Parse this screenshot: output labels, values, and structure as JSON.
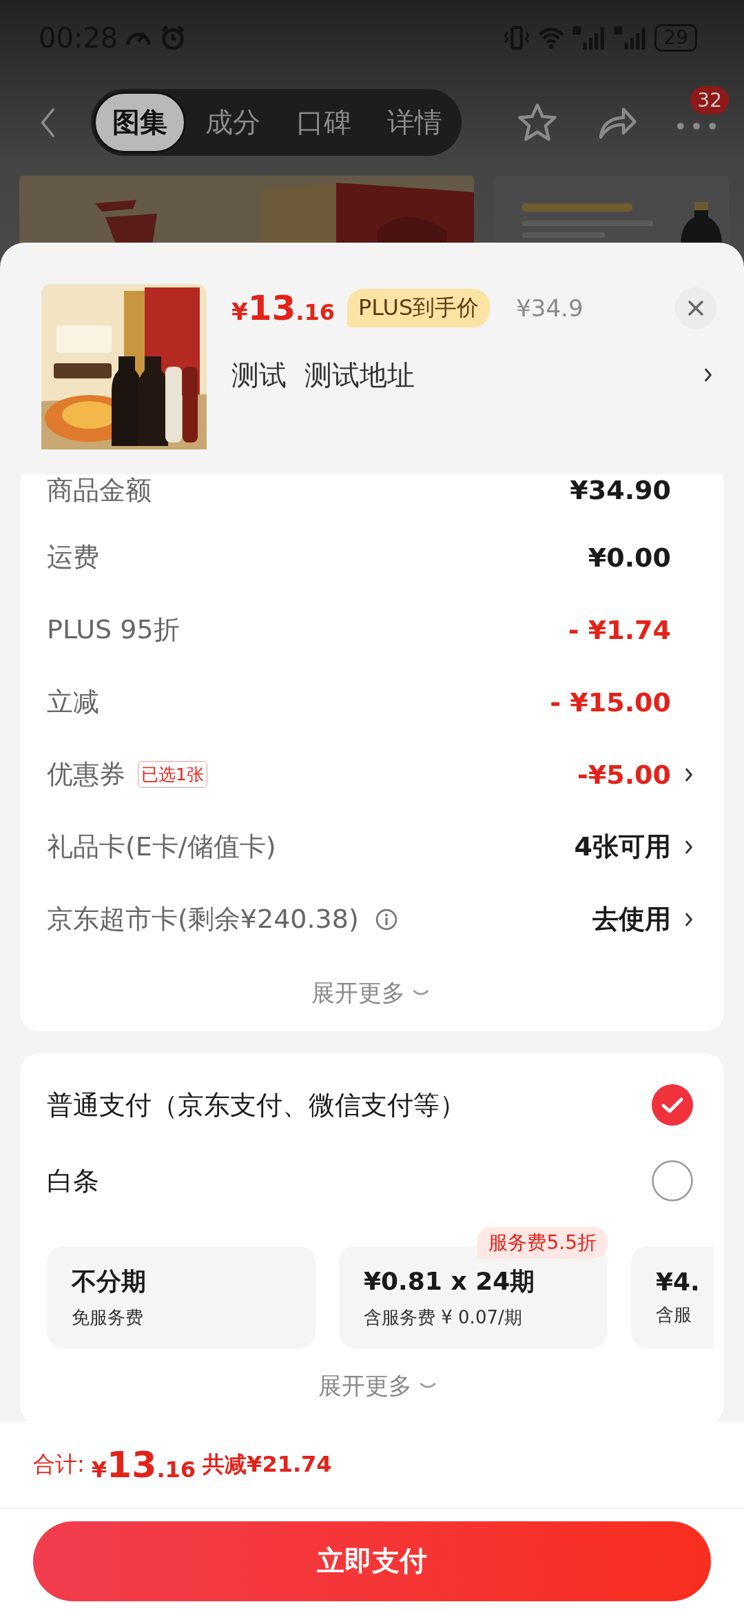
{
  "status_bar": {
    "time": "00:28",
    "battery": "29"
  },
  "nav": {
    "tabs": [
      {
        "label": "图集",
        "selected": true
      },
      {
        "label": "成分",
        "selected": false
      },
      {
        "label": "口碑",
        "selected": false
      },
      {
        "label": "详情",
        "selected": false
      }
    ],
    "badge": "32"
  },
  "product": {
    "currency": "¥",
    "price_main": "13",
    "price_decimal": ".16",
    "price_tag": "PLUS到手价",
    "original_price": "¥34.9",
    "recipient": "测试",
    "address": "测试地址"
  },
  "summary": {
    "rows": [
      {
        "label": "商品金额",
        "value": "¥34.90",
        "kind": "plain",
        "arrow": false
      },
      {
        "label": "运费",
        "value": "¥0.00",
        "kind": "plain",
        "arrow": false
      },
      {
        "label": "PLUS 95折",
        "value": "- ¥1.74",
        "kind": "discount",
        "arrow": false
      },
      {
        "label": "立减",
        "value": "- ¥15.00",
        "kind": "discount",
        "arrow": false
      },
      {
        "label": "优惠券",
        "tag": "已选1张",
        "value": "-¥5.00",
        "kind": "discount",
        "arrow": true
      },
      {
        "label": "礼品卡(E卡/储值卡)",
        "value": "4张可用",
        "kind": "plain",
        "arrow": true
      },
      {
        "label": "京东超市卡(剩余¥240.38)",
        "info": true,
        "value": "去使用",
        "kind": "plain",
        "arrow": true
      }
    ],
    "more": "展开更多"
  },
  "payment": {
    "methods": [
      {
        "label": "普通支付（京东支付、微信支付等）",
        "selected": true
      },
      {
        "label": "白条",
        "selected": false
      }
    ],
    "plans": [
      {
        "title": "不分期",
        "subtitle": "免服务费"
      },
      {
        "title": "¥0.81 x 24期",
        "subtitle": "含服务费 ¥ 0.07/期",
        "badge": "服务费5.5折"
      },
      {
        "title": "¥4.",
        "subtitle": "含服"
      }
    ],
    "more": "展开更多"
  },
  "footer": {
    "total_label": "合计:",
    "currency": "¥",
    "total_main": "13",
    "total_decimal": ".16",
    "saving": "共减¥21.74",
    "pay_button": "立即支付"
  }
}
